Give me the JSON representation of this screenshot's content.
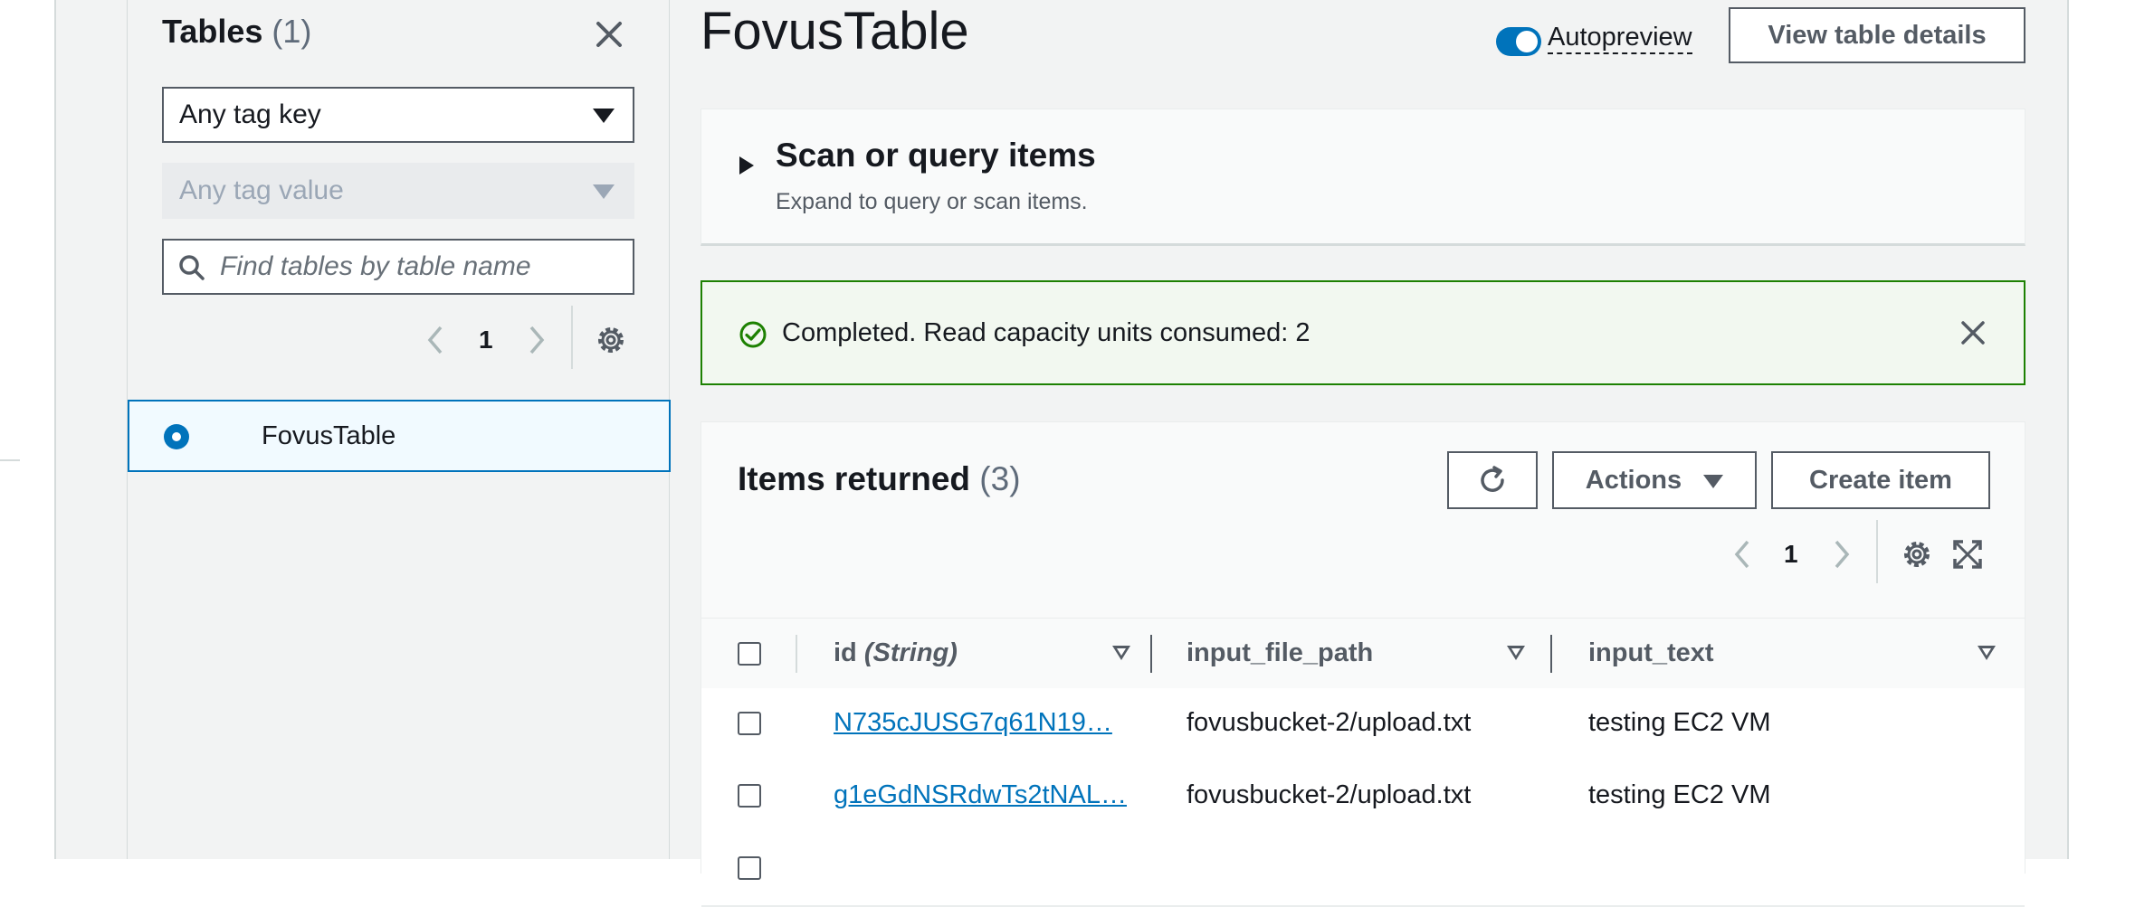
{
  "sidebar": {
    "title": "Tables",
    "count": "(1)",
    "tag_key_select": "Any tag key",
    "tag_value_select": "Any tag value",
    "search_placeholder": "Find tables by table name",
    "page_number": "1",
    "tables": [
      {
        "name": "FovusTable",
        "selected": true
      }
    ]
  },
  "header": {
    "title": "FovusTable",
    "autopreview_label": "Autopreview",
    "autopreview_on": true,
    "view_details_button": "View table details"
  },
  "scan_section": {
    "title": "Scan or query items",
    "description": "Expand to query or scan items."
  },
  "alert": {
    "status": "success",
    "message": "Completed. Read capacity units consumed: 2"
  },
  "items": {
    "title": "Items returned",
    "count": "(3)",
    "actions_button": "Actions",
    "create_button": "Create item",
    "page_number": "1",
    "columns": [
      {
        "name": "id",
        "type": "(String)"
      },
      {
        "name": "input_file_path"
      },
      {
        "name": "input_text"
      }
    ],
    "rows": [
      {
        "id": "N735cJUSG7q61N19…",
        "input_file_path": "fovusbucket-2/upload.txt",
        "input_text": "testing EC2 VM"
      },
      {
        "id": "g1eGdNSRdwTs2tNAL…",
        "input_file_path": "fovusbucket-2/upload.txt",
        "input_text": "testing EC2 VM"
      }
    ]
  },
  "colors": {
    "link": "#0073bb",
    "success": "#1d8102",
    "border": "#545b64"
  }
}
